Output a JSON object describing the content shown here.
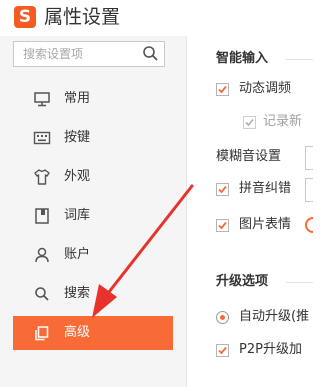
{
  "window": {
    "title": "属性设置",
    "logo_letter": "S",
    "brand_color": "#f55a22"
  },
  "sidebar": {
    "search_placeholder": "搜索设置项",
    "items": [
      {
        "label": "常用",
        "icon": "monitor-icon",
        "active": false
      },
      {
        "label": "按键",
        "icon": "keyboard-icon",
        "active": false
      },
      {
        "label": "外观",
        "icon": "tshirt-icon",
        "active": false
      },
      {
        "label": "词库",
        "icon": "book-icon",
        "active": false
      },
      {
        "label": "账户",
        "icon": "user-icon",
        "active": false
      },
      {
        "label": "搜索",
        "icon": "search-icon",
        "active": false
      },
      {
        "label": "高级",
        "icon": "advanced-icon",
        "active": true
      }
    ],
    "active_color": "#f86a36"
  },
  "content": {
    "smart_input": {
      "heading": "智能输入",
      "dynamic_freq": {
        "label": "动态调频",
        "checked": true
      },
      "record_new": {
        "label": "记录新",
        "checked": true,
        "disabled": true
      },
      "fuzzy_label": "模糊音设置",
      "pinyin_correction": {
        "label": "拼音纠错",
        "checked": true
      },
      "picture_emoji": {
        "label": "图片表情",
        "checked": true
      }
    },
    "upgrade": {
      "heading": "升级选项",
      "auto_upgrade": {
        "label": "自动升级(推",
        "selected": true
      },
      "p2p_upgrade": {
        "label": "P2P升级加",
        "checked": true
      }
    }
  }
}
